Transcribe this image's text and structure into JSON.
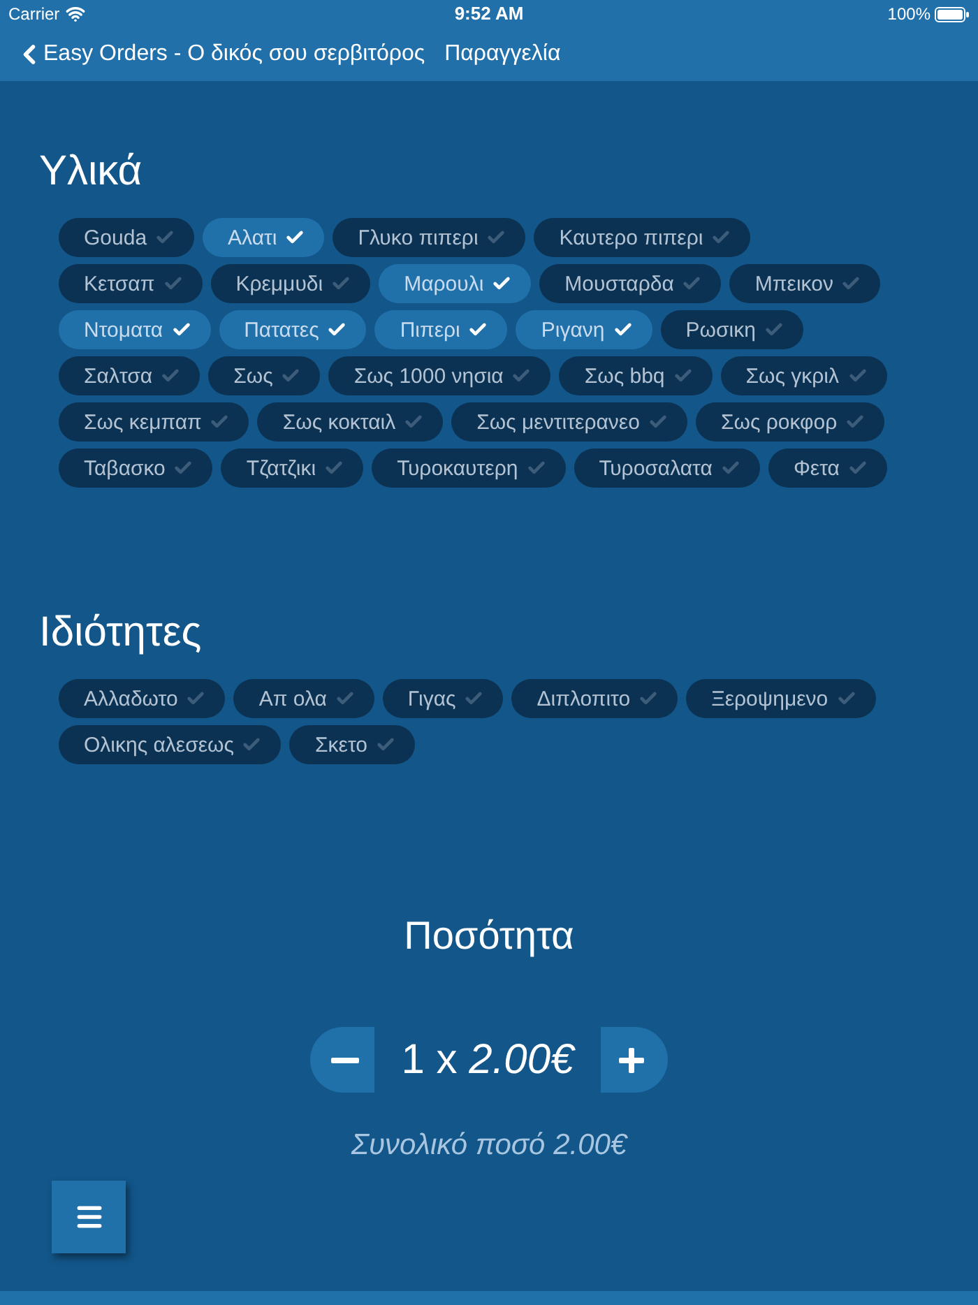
{
  "status_bar": {
    "carrier": "Carrier",
    "time": "9:52 AM",
    "battery": "100%"
  },
  "nav_bar": {
    "back_label": "Easy Orders - Ο δικός σου σερβιτόρος",
    "title": "Παραγγελία"
  },
  "ingredients": {
    "title": "Υλικά",
    "items": [
      {
        "label": "Gouda",
        "selected": false
      },
      {
        "label": "Αλατι",
        "selected": true
      },
      {
        "label": "Γλυκο πιπερι",
        "selected": false
      },
      {
        "label": "Καυτερο πιπερι",
        "selected": false
      },
      {
        "label": "Κετσαπ",
        "selected": false
      },
      {
        "label": "Κρεμμυδι",
        "selected": false
      },
      {
        "label": "Μαρουλι",
        "selected": true
      },
      {
        "label": "Μουσταρδα",
        "selected": false
      },
      {
        "label": "Μπεικον",
        "selected": false
      },
      {
        "label": "Ντοματα",
        "selected": true
      },
      {
        "label": "Πατατες",
        "selected": true
      },
      {
        "label": "Πιπερι",
        "selected": true
      },
      {
        "label": "Ριγανη",
        "selected": true
      },
      {
        "label": "Ρωσικη",
        "selected": false
      },
      {
        "label": "Σαλτσα",
        "selected": false
      },
      {
        "label": "Σως",
        "selected": false
      },
      {
        "label": "Σως 1000 νησια",
        "selected": false
      },
      {
        "label": "Σως bbq",
        "selected": false
      },
      {
        "label": "Σως γκριλ",
        "selected": false
      },
      {
        "label": "Σως κεμπαπ",
        "selected": false
      },
      {
        "label": "Σως κοκταιλ",
        "selected": false
      },
      {
        "label": "Σως μεντιτερανεο",
        "selected": false
      },
      {
        "label": "Σως ροκφορ",
        "selected": false
      },
      {
        "label": "Ταβασκο",
        "selected": false
      },
      {
        "label": "Τζατζικι",
        "selected": false
      },
      {
        "label": "Τυροκαυτερη",
        "selected": false
      },
      {
        "label": "Τυροσαλατα",
        "selected": false
      },
      {
        "label": "Φετα",
        "selected": false
      }
    ]
  },
  "properties": {
    "title": "Ιδιότητες",
    "items": [
      {
        "label": "Αλλαδωτο",
        "selected": false
      },
      {
        "label": "Απ ολα",
        "selected": false
      },
      {
        "label": "Γιγας",
        "selected": false
      },
      {
        "label": "Διπλοπιτο",
        "selected": false
      },
      {
        "label": "Ξεροψημενο",
        "selected": false
      },
      {
        "label": "Ολικης αλεσεως",
        "selected": false
      },
      {
        "label": "Σκετο",
        "selected": false
      }
    ]
  },
  "quantity": {
    "title": "Ποσότητα",
    "amount": "1 x *2.00€*",
    "total": "Συνολικό ποσό 2.00€"
  }
}
